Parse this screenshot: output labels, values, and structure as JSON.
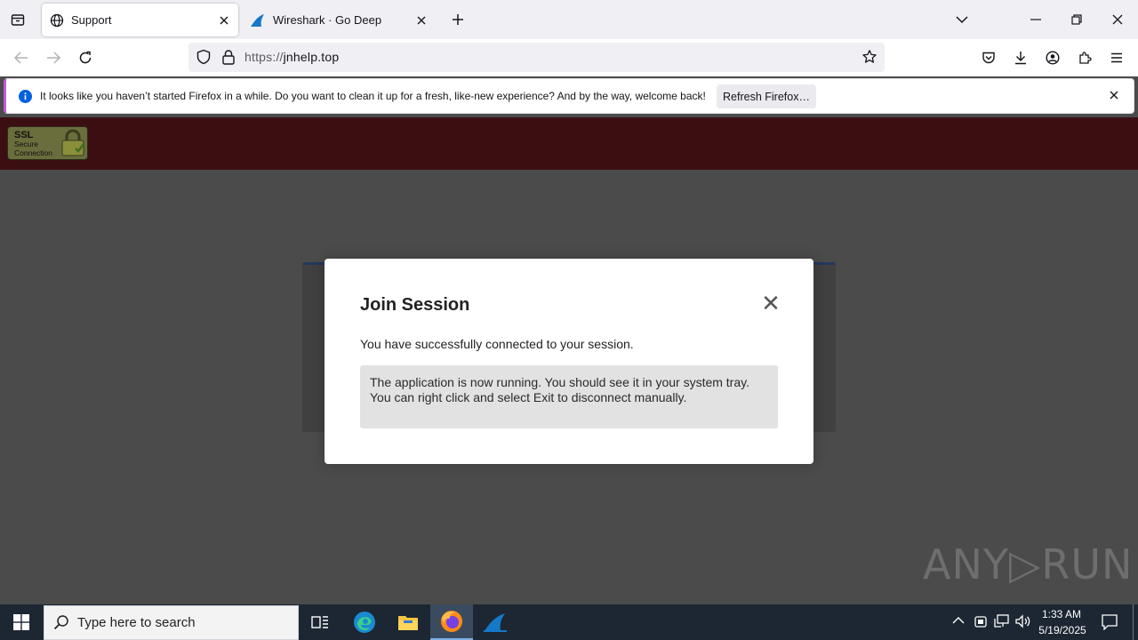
{
  "browser": {
    "tabs": [
      {
        "label": "Support",
        "icon": "globe-icon",
        "active": true
      },
      {
        "label": "Wireshark · Go Deep",
        "icon": "wireshark-fin-icon",
        "active": false
      }
    ],
    "url": {
      "prefix": "https://",
      "host": "jnhelp.top"
    }
  },
  "notification": {
    "text": "It looks like you haven’t started Firefox in a while. Do you want to clean it up for a fresh, like-new experience? And by the way, welcome back!",
    "button_label": "Refresh Firefox…"
  },
  "page": {
    "ssl_badge": {
      "line1": "SSL",
      "line2": "Secure",
      "line3": "Connection"
    }
  },
  "modal": {
    "title": "Join Session",
    "close_glyph": "✕",
    "message": "You have successfully connected to your session.",
    "info_line1": "The application is now running. You should see it in your system tray.",
    "info_line2": "You can right click and select Exit to disconnect manually."
  },
  "watermark": "ANY▷RUN",
  "taskbar": {
    "search_placeholder": "Type here to search",
    "time": "1:33 AM",
    "date": "5/19/2025"
  }
}
